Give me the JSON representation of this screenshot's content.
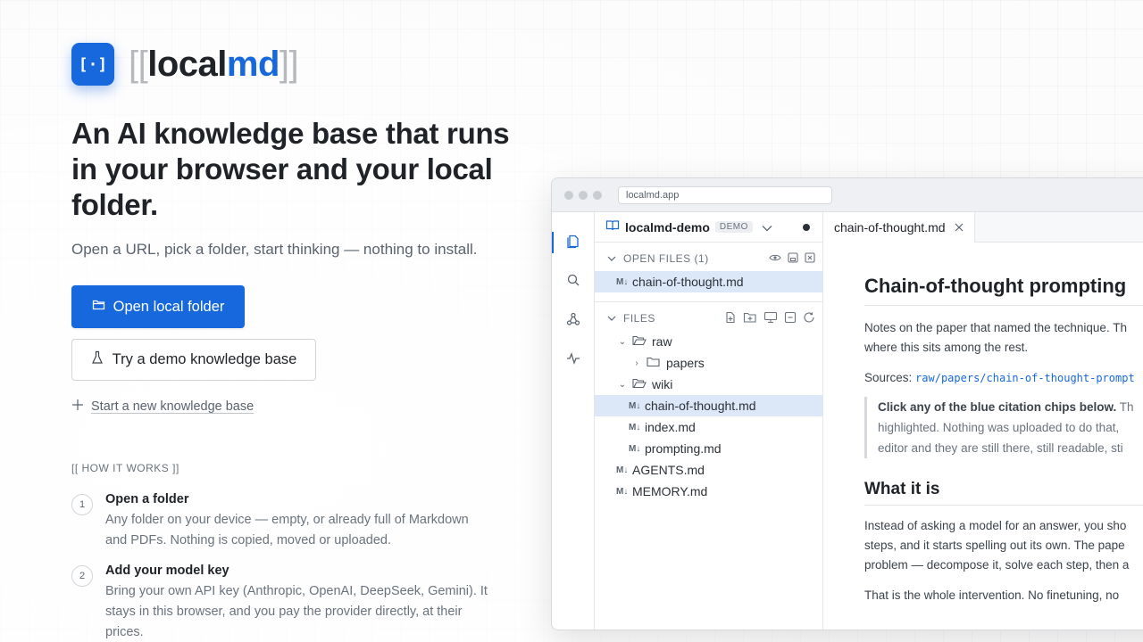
{
  "brand": {
    "mark": "[·]",
    "open_bracket": "[[",
    "name_a": "local",
    "name_b": "md",
    "close_bracket": "]]",
    "accent": "#1668dc"
  },
  "hero": {
    "headline": "An AI knowledge base that runs in your browser and your local folder.",
    "tagline": "Open a URL, pick a folder, start thinking — nothing to install.",
    "primary_button": "Open local folder",
    "secondary_button": "Try a demo knowledge base",
    "new_link": "Start a new knowledge base"
  },
  "how": {
    "title": "[[ HOW IT WORKS ]]",
    "steps": [
      {
        "num": "1",
        "title": "Open a folder",
        "text": "Any folder on your device — empty, or already full of Markdown and PDFs. Nothing is copied, moved or uploaded."
      },
      {
        "num": "2",
        "title": "Add your model key",
        "text": "Bring your own API key (Anthropic, OpenAI, DeepSeek, Gemini). It stays in this browser, and you pay the provider directly, at their prices."
      }
    ]
  },
  "window": {
    "url": "localmd.app",
    "workspace": "localmd-demo",
    "badge": "DEMO",
    "open_files_label": "OPEN FILES (1)",
    "open_file": "chain-of-thought.md",
    "files_label": "FILES",
    "tree": {
      "raw": "raw",
      "papers": "papers",
      "wiki": "wiki",
      "f1": "chain-of-thought.md",
      "f2": "index.md",
      "f3": "prompting.md",
      "f4": "AGENTS.md",
      "f5": "MEMORY.md"
    },
    "tab": "chain-of-thought.md",
    "doc": {
      "title": "Chain-of-thought prompting",
      "p1a": "Notes on the paper that named the technique. Th",
      "p1b": "where this sits among the rest.",
      "sources_label": "Sources:",
      "sources_path": "raw/papers/chain-of-thought-prompt",
      "quote_bold": "Click any of the blue citation chips below.",
      "quote_a": " Th",
      "quote_b": "highlighted. Nothing was uploaded to do that,",
      "quote_c": "editor and they are still there, still readable, sti",
      "h_what": "What it is",
      "p2a": "Instead of asking a model for an answer, you sho",
      "p2b": "steps, and it starts spelling out its own. The pape",
      "p2c": "problem — decompose it, solve each step, then a",
      "p3a": "That is the whole intervention. No finetuning, no"
    }
  }
}
